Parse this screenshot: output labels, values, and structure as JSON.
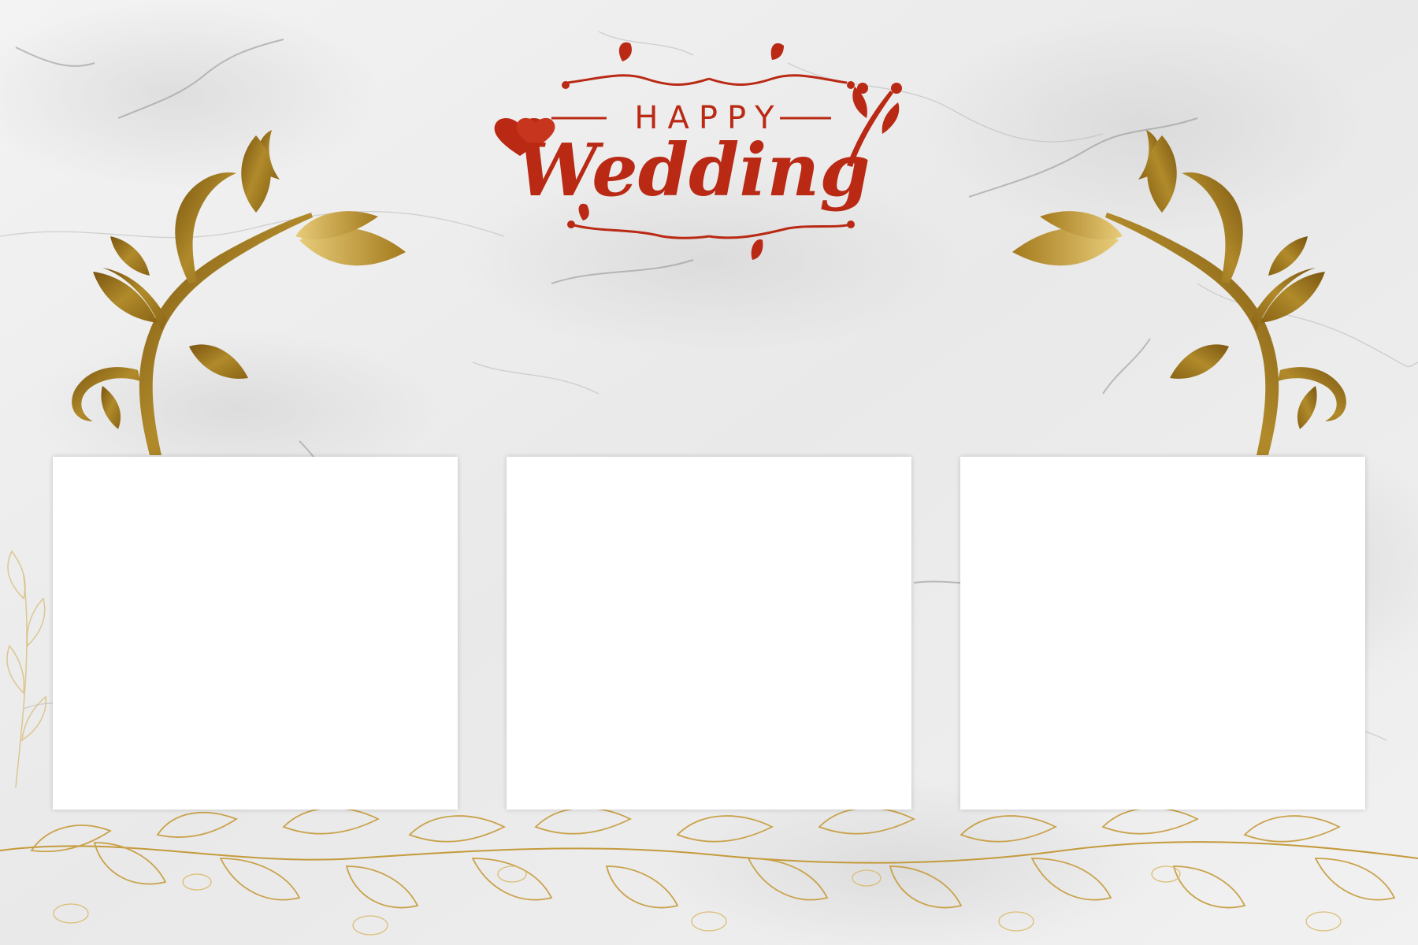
{
  "title": {
    "happy": "HAPPY",
    "wedding": "Wedding"
  },
  "colors": {
    "title_red": "#b92914",
    "gold": "#9c7418",
    "gold_light": "#d6b25a",
    "marble_base": "#eeeeee",
    "slot_fill": "#ffffff"
  },
  "photo_slots": [
    {
      "label": "",
      "state": "empty"
    },
    {
      "label": "",
      "state": "empty"
    },
    {
      "label": "",
      "state": "empty"
    }
  ],
  "icons": {
    "hearts": "double-heart-icon",
    "ornament_left": "gold-swirl-vine-icon",
    "ornament_right": "gold-swirl-vine-icon",
    "border_bottom": "gold-leaf-garland-icon"
  }
}
